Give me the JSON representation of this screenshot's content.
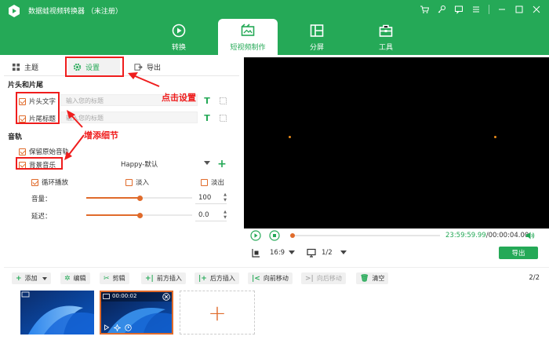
{
  "app": {
    "title": "数据蛙视频转换器 （未注册）"
  },
  "main_tabs": [
    {
      "label": "转换",
      "icon": "convert-icon"
    },
    {
      "label": "短视频制作",
      "icon": "mv-icon",
      "active": true
    },
    {
      "label": "分屏",
      "icon": "split-screen-icon"
    },
    {
      "label": "工具",
      "icon": "toolbox-icon"
    }
  ],
  "sub_tabs": [
    {
      "label": "主题",
      "icon": "theme-icon"
    },
    {
      "label": "设置",
      "icon": "gear-icon",
      "active": true
    },
    {
      "label": "导出",
      "icon": "export-icon"
    }
  ],
  "settings": {
    "section_titles_label": "片头和片尾",
    "opening_title_label": "片头文字",
    "opening_title_placeholder": "输入您的标题",
    "ending_title_label": "片尾标题",
    "ending_title_placeholder": "输入您的标题",
    "audio_section_label": "音轨",
    "keep_audio_label": "保留原始音轨",
    "bg_music_label": "背景音乐",
    "bg_music_value": "Happy-默认",
    "loop_label": "循环播放",
    "fade_in_label": "淡入",
    "fade_out_label": "淡出",
    "volume_label": "音量：",
    "volume_value": "100",
    "volume_level": 0.5,
    "delay_label": "延迟：",
    "delay_value": "0.0",
    "delay_level": 0.5
  },
  "annotations": {
    "click_settings": "点击设置",
    "add_details": "增添细节"
  },
  "player": {
    "current_time": "23:59:59.99",
    "total_time": "/00:00:04.00",
    "aspect_ratio": "16:9",
    "page": "1/2",
    "export_label": "导出"
  },
  "toolbar": {
    "add": "添加",
    "edit": "编辑",
    "cut": "剪辑",
    "insert_before": "前方插入",
    "insert_after": "后方插入",
    "move_forward": "向前移动",
    "move_backward": "向后移动",
    "clear": "清空",
    "page_count": "2/2"
  },
  "timeline": {
    "clip2_duration": "00:00:02",
    "add_symbol": "+"
  },
  "colors": {
    "brand_green": "#25a957",
    "accent_orange": "#e06b2b",
    "annotation_red": "#ef1d1d"
  }
}
